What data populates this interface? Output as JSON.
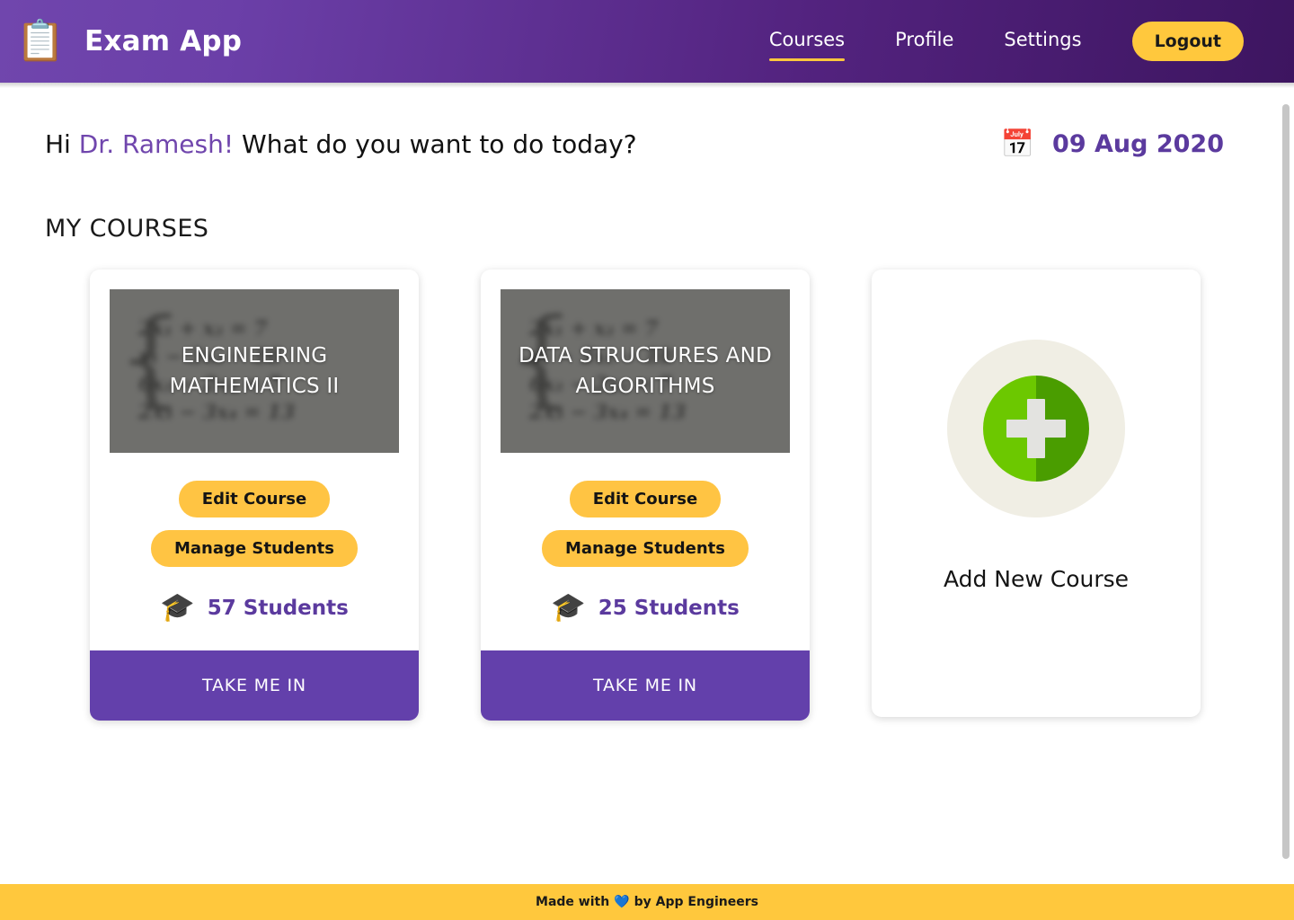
{
  "header": {
    "brand_icon": "clipboard-icon",
    "brand_icon_glyph": "📋",
    "title": "Exam App",
    "nav": [
      {
        "label": "Courses",
        "active": true
      },
      {
        "label": "Profile",
        "active": false
      },
      {
        "label": "Settings",
        "active": false
      }
    ],
    "logout_label": "Logout",
    "gradient_from": "#7046ad",
    "gradient_to": "#3d1560",
    "accent": "#ffc83d"
  },
  "greeting": {
    "prefix": "Hi ",
    "name": "Dr. Ramesh!",
    "question": " What do you want to do today?",
    "name_color": "#7046ad"
  },
  "date": {
    "icon": "calendar-icon",
    "icon_glyph": "📅",
    "value": "09 Aug 2020",
    "color": "#5b3a9e"
  },
  "section": {
    "title": "MY COURSES"
  },
  "courses": [
    {
      "title": "ENGINEERING MATHEMATICS II",
      "edit_label": "Edit Course",
      "manage_label": "Manage Students",
      "students_icon": "graduation-cap-icon",
      "students_icon_glyph": "🎓",
      "students_count": "57 Students",
      "enter_label": "TAKE ME IN",
      "thumb_equations": [
        "2x₁ + x₂ = 7",
        "x₁  −  3x₃ − 10",
        "6x₂ − 2x₃ = 7",
        "2x₃ − 3x₄ = 13"
      ]
    },
    {
      "title": "DATA STRUCTURES AND ALGORITHMS",
      "edit_label": "Edit Course",
      "manage_label": "Manage Students",
      "students_icon": "graduation-cap-icon",
      "students_icon_glyph": "🎓",
      "students_count": "25 Students",
      "enter_label": "TAKE ME IN",
      "thumb_equations": [
        "2x₁ + x₂ = 7",
        "x₁  −  3x₃ − 10",
        "6x₂ − 2x₃ = 7",
        "2x₃ − 3x₄ = 13"
      ]
    }
  ],
  "add_course": {
    "icon": "plus-circle-icon",
    "label": "Add New Course",
    "plus_color": "#6cc800",
    "halo_color": "#f0eee4"
  },
  "footer": {
    "prefix": "Made with",
    "heart_icon": "blue-heart-icon",
    "heart_glyph": "💙",
    "suffix": "by App Engineers",
    "background": "#ffc83d"
  },
  "card_footer_color": "#6340ab",
  "button_color": "#ffc443"
}
